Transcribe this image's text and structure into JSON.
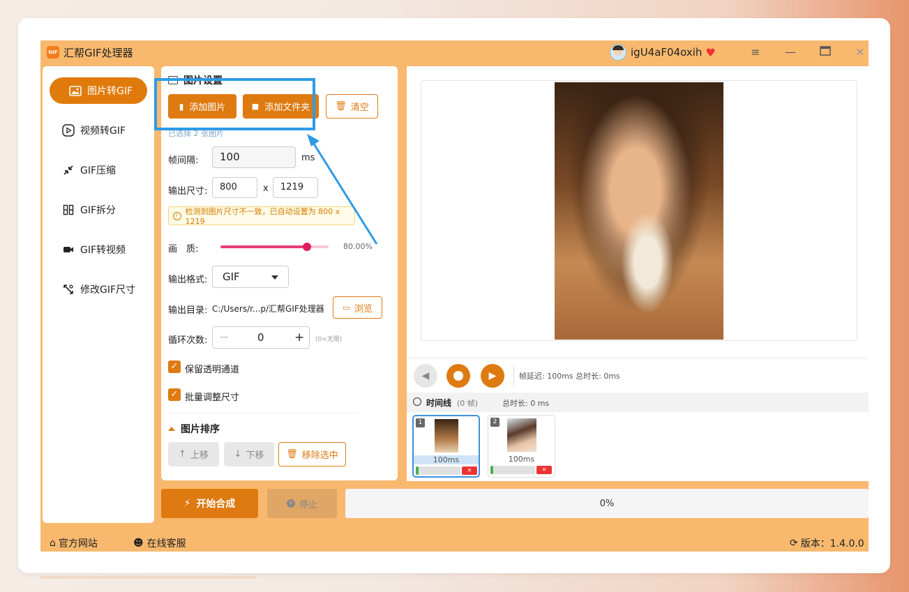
{
  "app": {
    "title": "汇帮GIF处理器",
    "logo_text": "GIF",
    "username": "igU4aF04oxih"
  },
  "sidebar": {
    "items": [
      {
        "label": "图片转GIF",
        "icon": "image-icon",
        "active": true
      },
      {
        "label": "视频转GIF",
        "icon": "play-circle-icon",
        "active": false
      },
      {
        "label": "GIF压缩",
        "icon": "compress-icon",
        "active": false
      },
      {
        "label": "GIF拆分",
        "icon": "split-icon",
        "active": false
      },
      {
        "label": "GIF转视频",
        "icon": "video-camera-icon",
        "active": false
      },
      {
        "label": "修改GIF尺寸",
        "icon": "resize-icon",
        "active": false
      }
    ]
  },
  "settings": {
    "section_title": "图片设置",
    "add_image": "添加图片",
    "add_folder": "添加文件夹",
    "clear": "清空",
    "selected_text": "已选择 2 张图片",
    "frame_interval_label": "帧间隔:",
    "frame_interval_value": "100",
    "frame_interval_unit": "ms",
    "output_size_label": "输出尺寸:",
    "width": "800",
    "size_sep": "x",
    "height": "1219",
    "warning": "检测到图片尺寸不一致，已自动设置为 800 x 1219",
    "quality_label": "画　质:",
    "quality_value": 0.8,
    "quality_text": "80.00%",
    "format_label": "输出格式:",
    "format_value": "GIF",
    "output_dir_label": "输出目录:",
    "output_dir_value": "C:/Users/r...p/汇帮GIF处理器",
    "browse": "浏览",
    "loop_label": "循环次数:",
    "loop_value": "0",
    "loop_hint": "(0=无限)",
    "keep_alpha": "保留透明通道",
    "batch_resize": "批量调整尺寸",
    "sort_title": "图片排序",
    "move_up": "上移",
    "move_down": "下移",
    "remove_selected": "移除选中"
  },
  "player": {
    "info": "帧延迟: 100ms  总时长: 0ms"
  },
  "timeline": {
    "title": "时间线",
    "count": "(0 帧)",
    "duration": "总时长: 0 ms",
    "frames": [
      {
        "num": "1",
        "ms": "100ms",
        "selected": true
      },
      {
        "num": "2",
        "ms": "100ms",
        "selected": false
      }
    ]
  },
  "actions": {
    "start": "开始合成",
    "stop": "停止",
    "progress": "0%"
  },
  "footer": {
    "website": "官方网站",
    "support": "在线客服",
    "version": "版本：1.4.0.0"
  },
  "colors": {
    "accent": "#de7a10",
    "frame": "#f8b96e",
    "highlight": "#2e9be6"
  }
}
